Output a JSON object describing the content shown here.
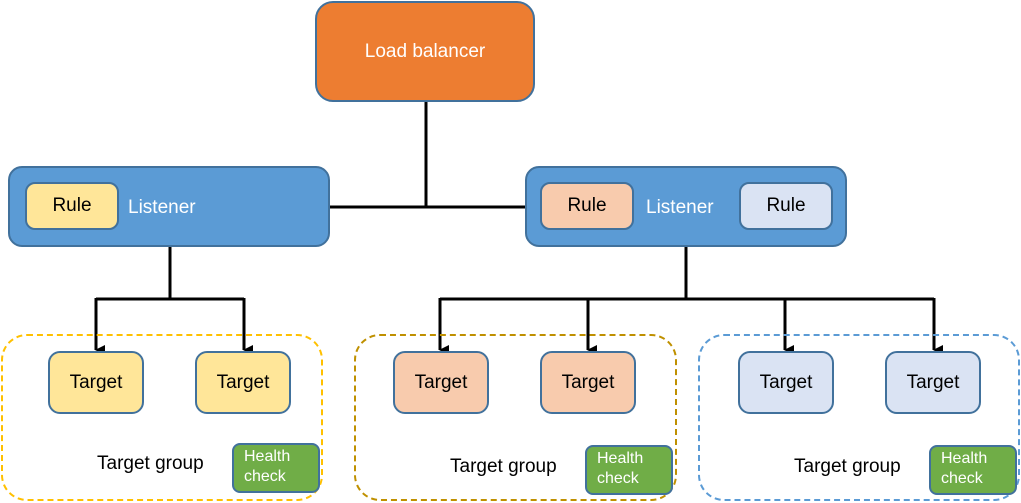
{
  "load_balancer": {
    "label": "Load balancer"
  },
  "listeners": [
    {
      "label": "Listener",
      "rules": [
        "Rule"
      ]
    },
    {
      "label": "Listener",
      "rules": [
        "Rule",
        "Rule"
      ]
    }
  ],
  "target_groups": [
    {
      "label": "Target group",
      "health_check": [
        "Health",
        "check"
      ],
      "targets": [
        "Target",
        "Target"
      ]
    },
    {
      "label": "Target group",
      "health_check": [
        "Health",
        "check"
      ],
      "targets": [
        "Target",
        "Target"
      ]
    },
    {
      "label": "Target group",
      "health_check": [
        "Health",
        "check"
      ],
      "targets": [
        "Target",
        "Target"
      ]
    }
  ],
  "colors": {
    "load_balancer": "#ed7d31",
    "listener": "#5b9bd5",
    "rule_group_1": "#ffe699",
    "rule_group_2": "#f8cbad",
    "rule_group_3": "#dae3f3",
    "health_check": "#70ad47",
    "group_1_border": "#ffc000",
    "group_2_border": "#bf9000",
    "group_3_border": "#5b9bd5"
  }
}
